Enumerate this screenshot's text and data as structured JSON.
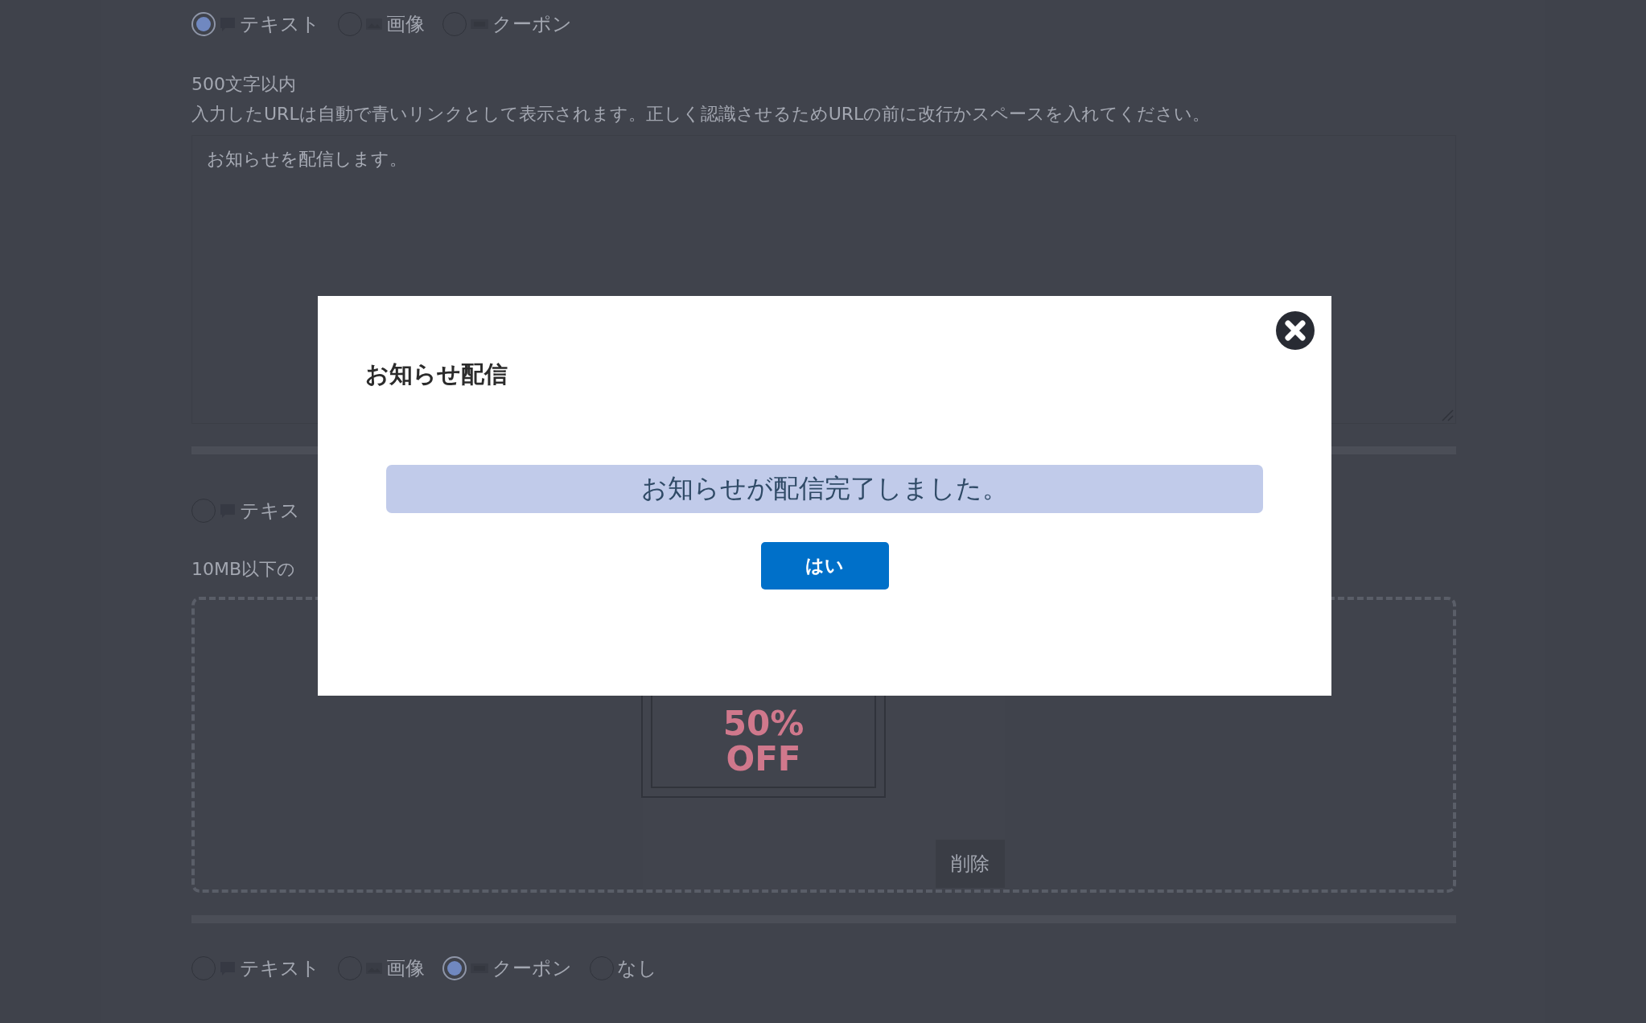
{
  "sections": [
    {
      "type_radios": [
        {
          "label": "テキスト",
          "kind": "text",
          "selected": true
        },
        {
          "label": "画像",
          "kind": "image",
          "selected": false
        },
        {
          "label": "クーポン",
          "kind": "coupon",
          "selected": false
        }
      ],
      "char_limit": "500文字以内",
      "hint": "入力したURLは自動で青いリンクとして表示されます。正しく認識させるためURLの前に改行かスペースを入れてください。",
      "message": {
        "value": "お知らせを配信します。"
      }
    },
    {
      "type_radios": [
        {
          "label": "テキス",
          "kind": "text",
          "selected": false
        }
      ],
      "size_hint": "10MB以下の",
      "coupon_preview": {
        "lines": [
          "50%",
          "OFF"
        ]
      },
      "delete_button": "削除"
    },
    {
      "type_radios": [
        {
          "label": "テキスト",
          "kind": "text",
          "selected": false
        },
        {
          "label": "画像",
          "kind": "image",
          "selected": false
        },
        {
          "label": "クーポン",
          "kind": "coupon",
          "selected": true
        },
        {
          "label": "なし",
          "kind": "none",
          "selected": false
        }
      ]
    }
  ],
  "modal": {
    "title": "お知らせ配信",
    "message": "お知らせが配信完了しました。",
    "ok_button": "はい"
  }
}
